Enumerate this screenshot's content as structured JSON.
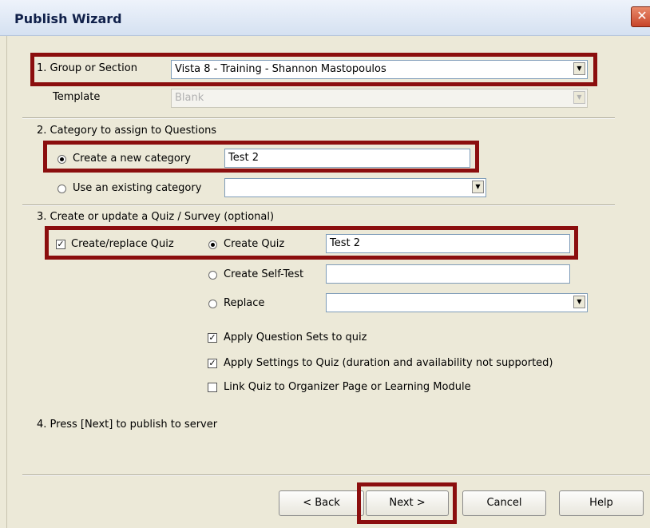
{
  "window": {
    "title": "Publish Wizard",
    "close_glyph": "✕"
  },
  "section1": {
    "group_label": "1.  Group or Section",
    "group_value": "Vista 8 - Training - Shannon Mastopoulos",
    "template_label": "Template",
    "template_value": "Blank"
  },
  "section2": {
    "heading": "2.  Category to assign to Questions",
    "new_category_label": "Create a new category",
    "new_category_value": "Test 2",
    "existing_category_label": "Use an existing category",
    "existing_category_value": ""
  },
  "section3": {
    "heading": "3.  Create or update a Quiz / Survey (optional)",
    "create_replace_label": "Create/replace Quiz",
    "create_quiz_label": "Create Quiz",
    "create_quiz_value": "Test 2",
    "self_test_label": "Create Self-Test",
    "self_test_value": "",
    "replace_label": "Replace",
    "replace_value": "",
    "apply_sets_label": "Apply Question Sets to quiz",
    "apply_settings_label": "Apply Settings to Quiz  (duration and availability not supported)",
    "link_quiz_label": "Link Quiz to Organizer Page or Learning Module"
  },
  "section4": {
    "text": "4.  Press [Next] to publish to server"
  },
  "buttons": {
    "back": "< Back",
    "next": "Next >",
    "cancel": "Cancel",
    "help": "Help"
  },
  "state": {
    "new_category_selected": true,
    "create_replace_checked": true,
    "create_quiz_selected": true,
    "apply_sets_checked": true,
    "apply_settings_checked": true,
    "link_quiz_checked": false
  },
  "colors": {
    "highlight": "#8b0e0e",
    "dialog_bg": "#ece9d8",
    "title_bg": "#d5e1f1"
  }
}
